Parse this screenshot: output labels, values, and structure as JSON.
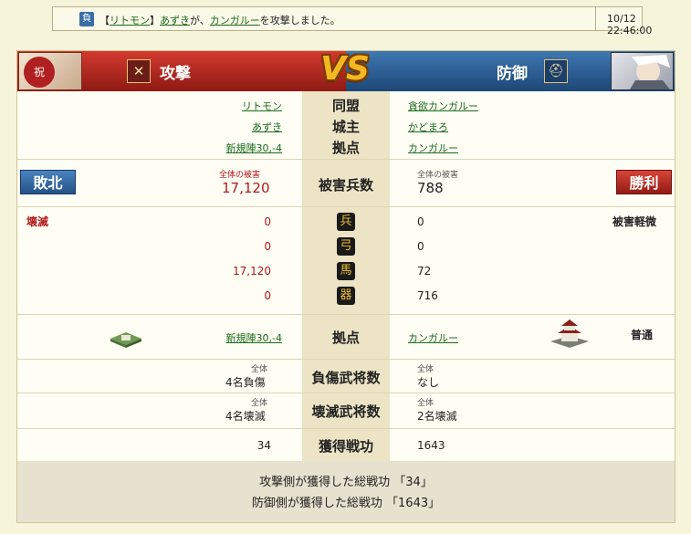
{
  "notice": {
    "badge": "負",
    "alliance_open": "【",
    "alliance_link": "リトモン",
    "alliance_close": "】",
    "player_link": "あずき",
    "middle": "が、",
    "target_link": "カンガルー",
    "suffix": "を攻撃しました。",
    "time": "10/12 22:46:00"
  },
  "header": {
    "attack_label": "攻撃",
    "defense_label": "防御",
    "vs": "VS",
    "left_avatar_text": "祝",
    "attack_icon": "crossed-swords-icon",
    "defense_icon": "helmet-icon"
  },
  "info": {
    "alliance_label": "同盟",
    "lord_label": "城主",
    "base_label": "拠点",
    "attacker": {
      "alliance": "リトモン",
      "lord": "あずき",
      "base": "新規陣30,-4"
    },
    "defender": {
      "alliance": "貪欲カンガルー",
      "lord": "かどまろ",
      "base": "カンガルー"
    }
  },
  "damage": {
    "label": "被害兵数",
    "total_caption": "全体の被害",
    "attacker_total": "17,120",
    "defender_total": "788",
    "defeat_button": "敗北",
    "victory_button": "勝利",
    "attacker_status": "壊滅",
    "defender_status": "被害軽微"
  },
  "units": [
    {
      "icon": "spearman-icon",
      "glyph": "兵",
      "attacker": "0",
      "defender": "0"
    },
    {
      "icon": "bow-icon",
      "glyph": "弓",
      "attacker": "0",
      "defender": "0"
    },
    {
      "icon": "horse-icon",
      "glyph": "馬",
      "attacker": "17,120",
      "defender": "72"
    },
    {
      "icon": "siege-icon",
      "glyph": "器",
      "attacker": "0",
      "defender": "716"
    }
  ],
  "base_row": {
    "label": "拠点",
    "attacker_base": "新規陣30,-4",
    "defender_base": "カンガルー",
    "defender_state": "普通"
  },
  "injured": {
    "label": "負傷武将数",
    "caption": "全体",
    "attacker": "4名負傷",
    "defender": "なし"
  },
  "destroyed": {
    "label": "壊滅武将数",
    "caption": "全体",
    "attacker": "4名壊滅",
    "defender": "2名壊滅"
  },
  "merit": {
    "label": "獲得戦功",
    "attacker": "34",
    "defender": "1643"
  },
  "footer": {
    "line1": "攻撃側が獲得した総戦功 「34」",
    "line2": "防御側が獲得した総戦功 「1643」"
  }
}
